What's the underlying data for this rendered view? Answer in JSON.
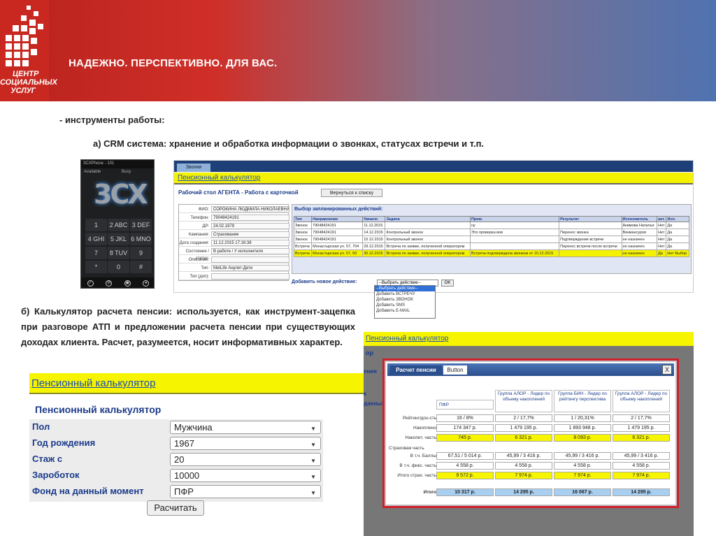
{
  "header": {
    "slogan": "НАДЕЖНО. ПЕРСПЕКТИВНО. ДЛЯ ВАС.",
    "logo_text": "ЦЕНТР СОЦИАЛЬНЫХ УСЛУГ"
  },
  "colors": {
    "header_start": "#c8281f",
    "header_end": "#4f73b1",
    "yellow": "#f5f200",
    "link_blue": "#1a4fb6"
  },
  "text": {
    "tools": "- инструменты работы:",
    "crm_desc": "а) CRM система: хранение и обработка информации о звонках, статусах встречи и т.п.",
    "calc_desc": "б) Калькулятор расчета пенсии: используется, как инструмент-зацепка при разговоре АТП и предложении расчета пенсии при существующих доходах клиента. Расчет, разумеется, носит информативных характер."
  },
  "phone": {
    "title": "3CXPhone - 101",
    "status": "Available",
    "status2": "Busy",
    "logo": "3CX",
    "keys": [
      "1",
      "2 ABC",
      "3 DEF",
      "4 GHI",
      "5 JKL",
      "6 MNO",
      "7 PQRS",
      "8 TUV",
      "9 WXYZ",
      "*",
      "0",
      "#"
    ],
    "bottom_icons": [
      "call-icon",
      "transfer-icon",
      "conference-icon",
      "hold-icon"
    ]
  },
  "crm": {
    "nav_tab": "Звонки",
    "yellow_title": "Пенсионный калькулятор",
    "workspace_title": "Рабочий стол АГЕНТА - Работа с карточкой",
    "back_button": "Вернуться к списку",
    "card": [
      {
        "label": "ФИО:",
        "value": "СОРОКИНА ЛЮДМИЛА НИКОЛАЕВНА"
      },
      {
        "label": "Телефон:",
        "value": "79048424191"
      },
      {
        "label": "ДР:",
        "value": "24.02.1979"
      },
      {
        "label": "Кампания:",
        "value": "Страхование"
      },
      {
        "label": "Дата создания:",
        "value": "11.12.2015 17:16:38"
      },
      {
        "label": "Состояние / статус:",
        "value": "В работе / У исполнителя"
      },
      {
        "label": "Описание:",
        "value": ""
      },
      {
        "label": "Тип:",
        "value": "MetLife Анулет-Дети"
      },
      {
        "label": "Тип (доп):",
        "value": ""
      }
    ],
    "schedule_title": "Выбор запланированных действий:",
    "schedule_headers": [
      "Тип",
      "Направление",
      "Начало",
      "Задача",
      "Прим.",
      "Результат",
      "Исполнитель",
      "акт.",
      "Исп."
    ],
    "schedule_rows": [
      {
        "cells": [
          "Звонок",
          "79048424191",
          "11.12.2015",
          "",
          "ну",
          "",
          "Акимова Наталья",
          "Нет",
          "Да"
        ],
        "hl": false
      },
      {
        "cells": [
          "Звонок",
          "79048424191",
          "14.12.2015",
          "Контрольный звонок",
          "Это проверка вов",
          "Перенос звонка",
          "Векмансуров",
          "Нет",
          "Да"
        ],
        "hl": false
      },
      {
        "cells": [
          "Звонок",
          "79048424191",
          "15.12.2015",
          "Контрольный звонок",
          "",
          "Подтверждение встречи",
          "не назначен",
          "Нет",
          "Да"
        ],
        "hl": false
      },
      {
        "cells": [
          "Встреча",
          "Монастырская ул. 57, 704",
          "29.12.2015",
          "Встреча по заявке, полученной оператором",
          "",
          "Перенос встречи после встречи",
          "не назначен",
          "Нет",
          "Да"
        ],
        "hl": false
      },
      {
        "cells": [
          "Встреча",
          "Монастырская ул. 57, 50",
          "30.12.2015",
          "Встреча по заявке, полученной оператором",
          "Встреча подтверждена звонком от 15.12.2015",
          "",
          "не назначен",
          "Да",
          "Нет Выбор"
        ],
        "hl": true
      }
    ],
    "add_action_label": "Добавить новое действие:",
    "add_action_value": "--Выбрать действие--",
    "ok_button": "OK",
    "dropdown_options": [
      "--Выбрать действие--",
      "Добавить ВСТРЕЧУ",
      "Добавить ЗВОНОК",
      "Добавить SMS",
      "Добавить E-MAIL"
    ]
  },
  "calc": {
    "yellow_title": "Пенсионный калькулятор",
    "subtitle": "Пенсионный калькулятор",
    "fields": [
      {
        "label": "Пол",
        "value": "Мужчина"
      },
      {
        "label": "Год рождения",
        "value": "1967"
      },
      {
        "label": "Стаж с",
        "value": "20"
      },
      {
        "label": "Зароботок",
        "value": "10000"
      },
      {
        "label": "Фонд на данный момент",
        "value": "ПФР"
      }
    ],
    "button": "Расчитать"
  },
  "dialog_bg": {
    "yellow_title": "Пенсионный калькулятор",
    "sub": "ор",
    "labels": [
      "ения",
      "",
      "к",
      "данный"
    ]
  },
  "dialog": {
    "tab_active": "Расчет пенсии",
    "tab": "Button",
    "close": "X",
    "columns": [
      "ПФР",
      "Группа АЛОР - Лидер по объему накоплений",
      "Группа БИН - Лидер по рейтингу перспектива",
      "Группа АЛОР - Лидер по объему накоплений"
    ],
    "rows": [
      {
        "label": "Рейтинг/дох-сть",
        "values": [
          "16 / 8%",
          "2 / 17,7%",
          "1 / 20,31%",
          "2 / 17,7%"
        ],
        "style": ""
      },
      {
        "label": "Накоплено",
        "values": [
          "174 347 р.",
          "1 479 195 р.",
          "1 893 948 р.",
          "1 479 195 р."
        ],
        "style": ""
      },
      {
        "label": "Накопит. часть",
        "values": [
          "745 р.",
          "6 321 р.",
          "8 093 р.",
          "6 321 р."
        ],
        "style": "y"
      },
      {
        "label": "Страховая часть",
        "values": [],
        "style": ""
      },
      {
        "label": "В т.ч. Баллы",
        "values": [
          "67,51 / 5 014 р.",
          "45,99 / 3 416 р.",
          "45,99 / 3 416 р.",
          "45,99 / 3 416 р."
        ],
        "style": ""
      },
      {
        "label": "В т.ч. фикс. часть",
        "values": [
          "4 558 р.",
          "4 558 р.",
          "4 558 р.",
          "4 558 р."
        ],
        "style": ""
      },
      {
        "label": "Итого страх. часть",
        "values": [
          "9 572 р.",
          "7 974 р.",
          "7 974 р.",
          "7 974 р."
        ],
        "style": "y"
      }
    ],
    "total_label": "Итого",
    "totals": [
      "10 317 р.",
      "14 295 р.",
      "16 067 р.",
      "14 295 р."
    ]
  }
}
